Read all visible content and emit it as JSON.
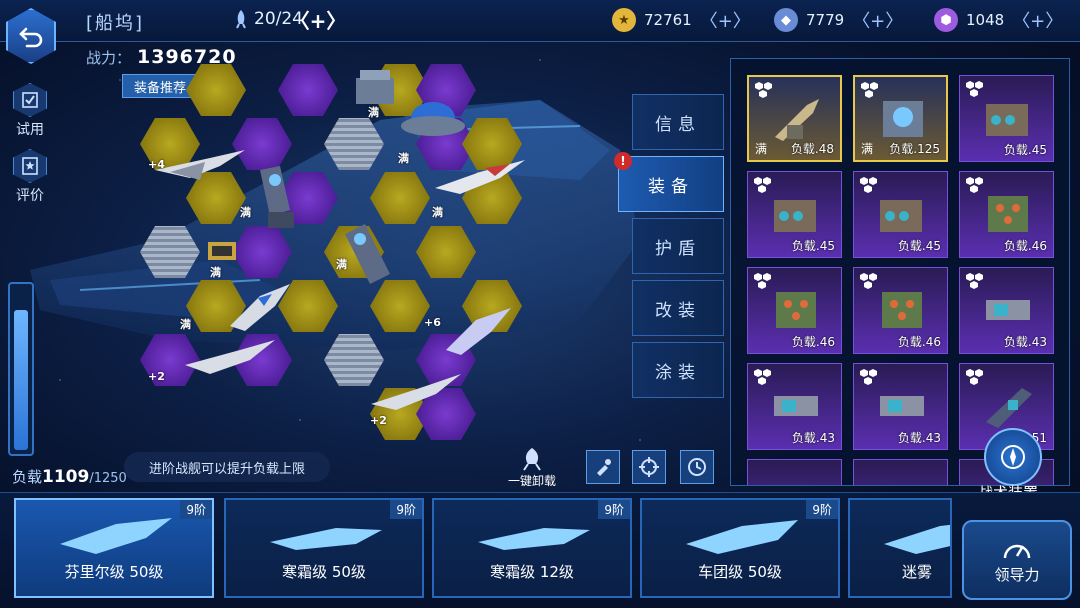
{
  "header": {
    "title": "[船坞]",
    "slots": "20/24",
    "power_label": "战力：",
    "power_value": "1396720",
    "recommend_label": "装备推荐"
  },
  "resources": [
    {
      "value": "72761",
      "icon": "gold-coin-icon",
      "color": "#e2b63a"
    },
    {
      "value": "7779",
      "icon": "crystal-icon",
      "color": "#6a8bd6"
    },
    {
      "value": "1048",
      "icon": "gem-icon",
      "color": "#9d5be0"
    }
  ],
  "side": {
    "trial_label": "试用",
    "review_label": "评价"
  },
  "load": {
    "label": "负载",
    "current": "1109",
    "max": "/1250",
    "hint": "进阶战舰可以提升负载上限"
  },
  "hex_labels": {
    "plus4": "+4",
    "full_a": "满",
    "full_b": "满",
    "full_c": "满",
    "full_d": "满",
    "full_e": "满",
    "full_f": "满",
    "plus6": "+6",
    "plus2_a": "+2",
    "plus2_b": "+2"
  },
  "nav_tabs": [
    {
      "label": "信息"
    },
    {
      "label": "装备"
    },
    {
      "label": "护盾"
    },
    {
      "label": "改装"
    },
    {
      "label": "涂装"
    }
  ],
  "inventory": [
    {
      "label": "负载.48",
      "full": "满",
      "rarity": "gold"
    },
    {
      "label": "负载.125",
      "full": "满",
      "rarity": "gold"
    },
    {
      "label": "负载.45",
      "rarity": "purple"
    },
    {
      "label": "负载.45",
      "rarity": "purple"
    },
    {
      "label": "负载.45",
      "rarity": "purple"
    },
    {
      "label": "负载.46",
      "rarity": "purple"
    },
    {
      "label": "负载.46",
      "rarity": "purple"
    },
    {
      "label": "负载.46",
      "rarity": "purple"
    },
    {
      "label": "负载.43",
      "rarity": "purple"
    },
    {
      "label": "负载.43",
      "rarity": "purple"
    },
    {
      "label": "负载.43",
      "rarity": "purple"
    },
    {
      "label": "负载.51",
      "rarity": "purple"
    }
  ],
  "tactical_label": "战术装置",
  "unload_label": "一键卸载",
  "ships": [
    {
      "name": "芬里尔级 50级",
      "tier": "9阶"
    },
    {
      "name": "寒霜级 50级",
      "tier": "9阶"
    },
    {
      "name": "寒霜级 12级",
      "tier": "9阶"
    },
    {
      "name": "车团级 50级",
      "tier": "9阶"
    },
    {
      "name": "迷雾",
      "tier": ""
    }
  ],
  "guide_label": "领导力"
}
